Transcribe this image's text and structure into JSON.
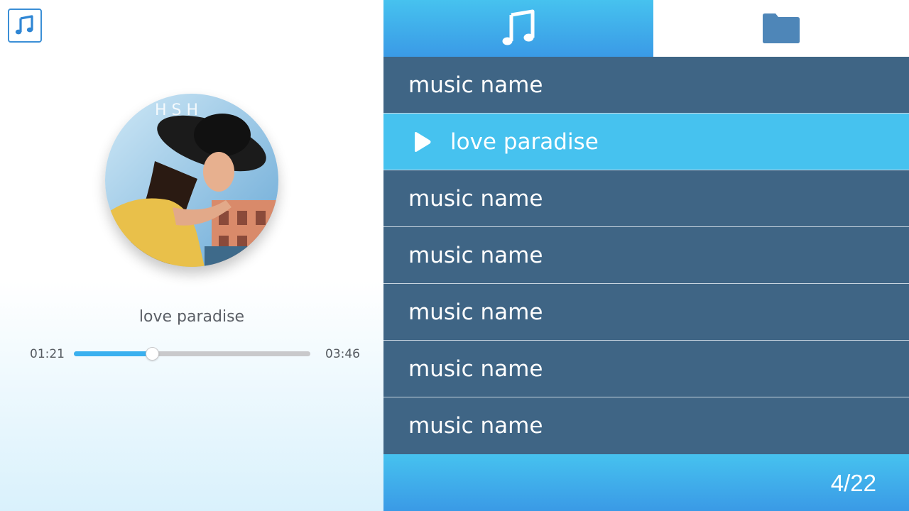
{
  "app": {
    "icon": "music-note-icon"
  },
  "now_playing": {
    "title": "love paradise",
    "current_time": "01:21",
    "total_time": "03:46",
    "progress": 0.33,
    "album_art": "album-cover"
  },
  "tabs": [
    {
      "name": "songs",
      "icon": "music-note-icon",
      "active": true
    },
    {
      "name": "folders",
      "icon": "folder-icon",
      "active": false
    }
  ],
  "playlist": {
    "items": [
      {
        "label": "music name",
        "playing": false
      },
      {
        "label": "love paradise",
        "playing": true
      },
      {
        "label": "music name",
        "playing": false
      },
      {
        "label": "music name",
        "playing": false
      },
      {
        "label": "music name",
        "playing": false
      },
      {
        "label": "music name",
        "playing": false
      },
      {
        "label": "music name",
        "playing": false
      }
    ]
  },
  "footer": {
    "page_count": "4/22"
  },
  "colors": {
    "accent": "#46c2ef",
    "list_bg": "#3f6585",
    "folder_icon": "#4e86b8"
  }
}
